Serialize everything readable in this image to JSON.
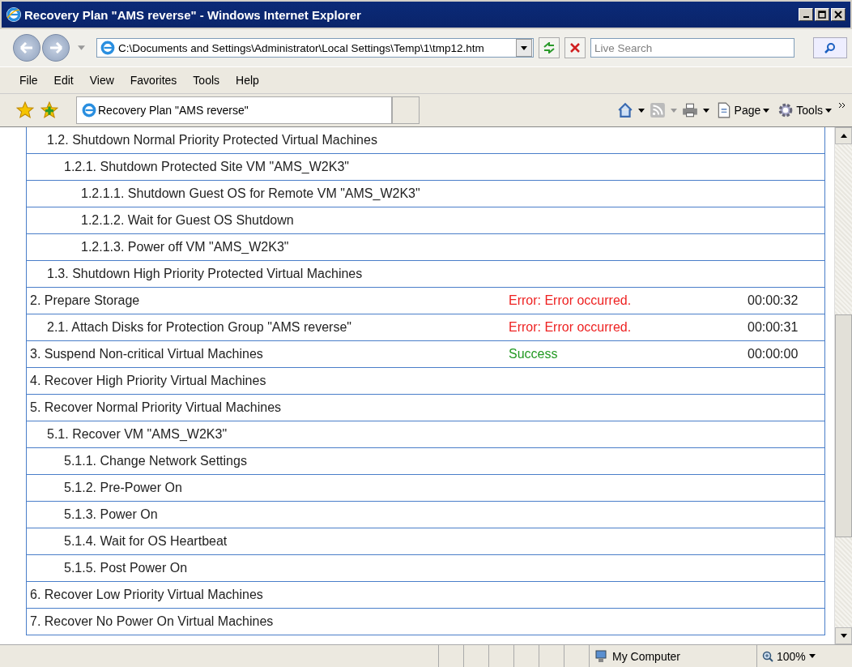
{
  "window": {
    "title": "Recovery Plan \"AMS reverse\" - Windows Internet Explorer"
  },
  "address_bar": {
    "url": "C:\\Documents and Settings\\Administrator\\Local Settings\\Temp\\1\\tmp12.htm"
  },
  "search": {
    "placeholder": "Live Search"
  },
  "menu": [
    "File",
    "Edit",
    "View",
    "Favorites",
    "Tools",
    "Help"
  ],
  "tab": {
    "label": "Recovery Plan \"AMS reverse\""
  },
  "command_bar": [
    "Page",
    "Tools"
  ],
  "steps": [
    {
      "children": [
        {
          "label": "1.2. Shutdown Normal Priority Protected Virtual Machines",
          "children": [
            {
              "label": "1.2.1. Shutdown Protected Site VM \"AMS_W2K3\"",
              "children": [
                {
                  "label": "1.2.1.1. Shutdown Guest OS for Remote VM \"AMS_W2K3\""
                },
                {
                  "label": "1.2.1.2. Wait for Guest OS Shutdown"
                },
                {
                  "label": "1.2.1.3. Power off VM \"AMS_W2K3\""
                }
              ]
            }
          ]
        },
        {
          "label": "1.3. Shutdown High Priority Protected Virtual Machines"
        }
      ]
    },
    {
      "label": "2. Prepare Storage",
      "status": {
        "text": "Error: Error occurred.",
        "kind": "error"
      },
      "time": "00:00:32",
      "children": [
        {
          "label": "2.1. Attach Disks for Protection Group \"AMS reverse\"",
          "status": {
            "text": "Error: Error occurred.",
            "kind": "error"
          },
          "time": "00:00:31"
        }
      ]
    },
    {
      "label": "3. Suspend Non-critical Virtual Machines",
      "status": {
        "text": "Success",
        "kind": "success"
      },
      "time": "00:00:00"
    },
    {
      "label": "4. Recover High Priority Virtual Machines"
    },
    {
      "label": "5. Recover Normal Priority Virtual Machines",
      "children": [
        {
          "label": "5.1. Recover VM \"AMS_W2K3\"",
          "children": [
            {
              "label": "5.1.1. Change Network Settings"
            },
            {
              "label": "5.1.2. Pre-Power On"
            },
            {
              "label": "5.1.3. Power On"
            },
            {
              "label": "5.1.4. Wait for OS Heartbeat"
            },
            {
              "label": "5.1.5. Post Power On"
            }
          ]
        }
      ]
    },
    {
      "label": "6. Recover Low Priority Virtual Machines"
    },
    {
      "label": "7. Recover No Power On Virtual Machines"
    }
  ],
  "status_bar": {
    "zone": "My Computer",
    "zoom": "100%"
  }
}
